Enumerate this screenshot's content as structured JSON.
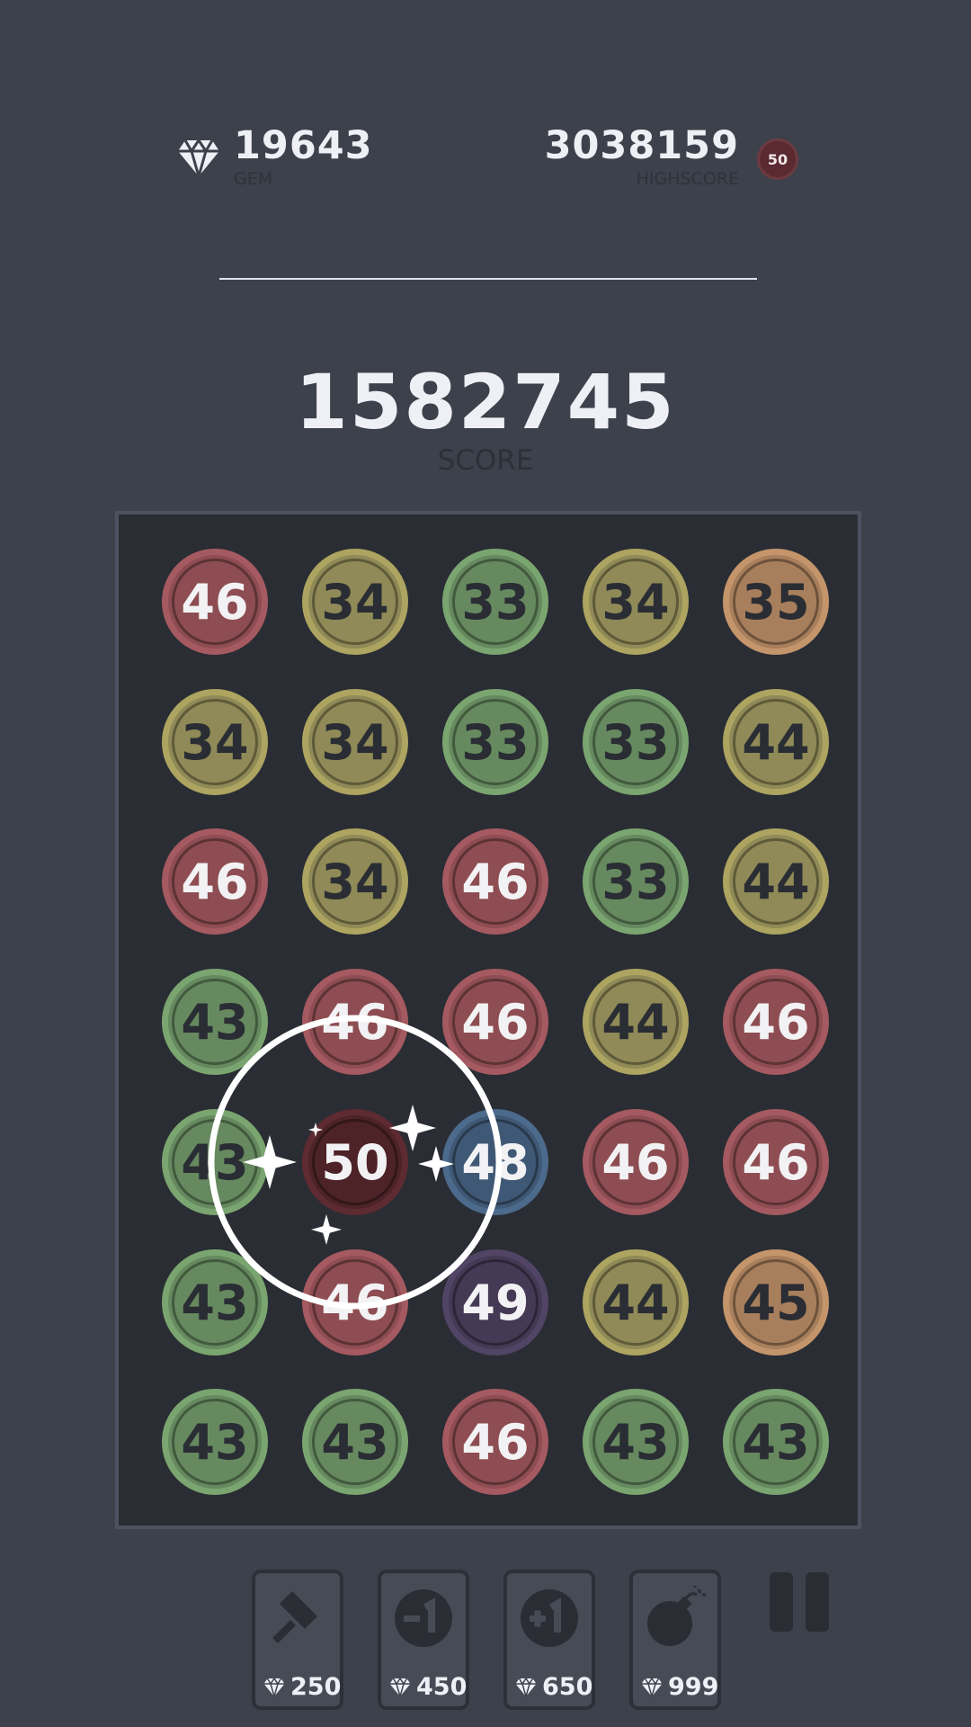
{
  "stats": {
    "gems": "19643",
    "gem_label": "GEM",
    "highscore": "3038159",
    "highscore_label": "HIGHSCORE",
    "highscore_badge": "50"
  },
  "score": {
    "value": "1582745",
    "label": "SCORE"
  },
  "board": {
    "rows": [
      [
        "46",
        "34",
        "33",
        "34",
        "35"
      ],
      [
        "34",
        "34",
        "33",
        "33",
        "44"
      ],
      [
        "46",
        "34",
        "46",
        "33",
        "44"
      ],
      [
        "43",
        "46",
        "46",
        "44",
        "46"
      ],
      [
        "43",
        "50",
        "48",
        "46",
        "46"
      ],
      [
        "43",
        "46",
        "49",
        "44",
        "45"
      ],
      [
        "43",
        "43",
        "46",
        "43",
        "43"
      ]
    ],
    "merge_effect": {
      "row": 4,
      "col": 1
    }
  },
  "tile_colors": {
    "33": {
      "fill": "#66895f",
      "ring": "#7aa570",
      "text": "#2a2d33"
    },
    "34": {
      "fill": "#8f8a57",
      "ring": "#aca460",
      "text": "#2a2d33"
    },
    "35": {
      "fill": "#a87f5c",
      "ring": "#c4956b",
      "text": "#2a2d33"
    },
    "43": {
      "fill": "#66895f",
      "ring": "#7aa570",
      "text": "#2a2d33"
    },
    "44": {
      "fill": "#8f8a57",
      "ring": "#aca460",
      "text": "#2a2d33"
    },
    "45": {
      "fill": "#a87f5c",
      "ring": "#c4956b",
      "text": "#2a2d33"
    },
    "46": {
      "fill": "#8e4d52",
      "ring": "#a45a60",
      "text": "#f2f2f4"
    },
    "48": {
      "fill": "#3f5875",
      "ring": "#4b6a8c",
      "text": "#f2f2f4"
    },
    "49": {
      "fill": "#453a55",
      "ring": "#514465",
      "text": "#f2f2f4"
    },
    "50": {
      "fill": "#4d2328",
      "ring": "#5d2b31",
      "text": "#f2f2f4"
    }
  },
  "tools": [
    {
      "icon": "hammer-icon",
      "price": "250"
    },
    {
      "icon": "minus-one-icon",
      "price": "450"
    },
    {
      "icon": "plus-one-icon",
      "price": "650"
    },
    {
      "icon": "bomb-icon",
      "price": "999"
    }
  ]
}
